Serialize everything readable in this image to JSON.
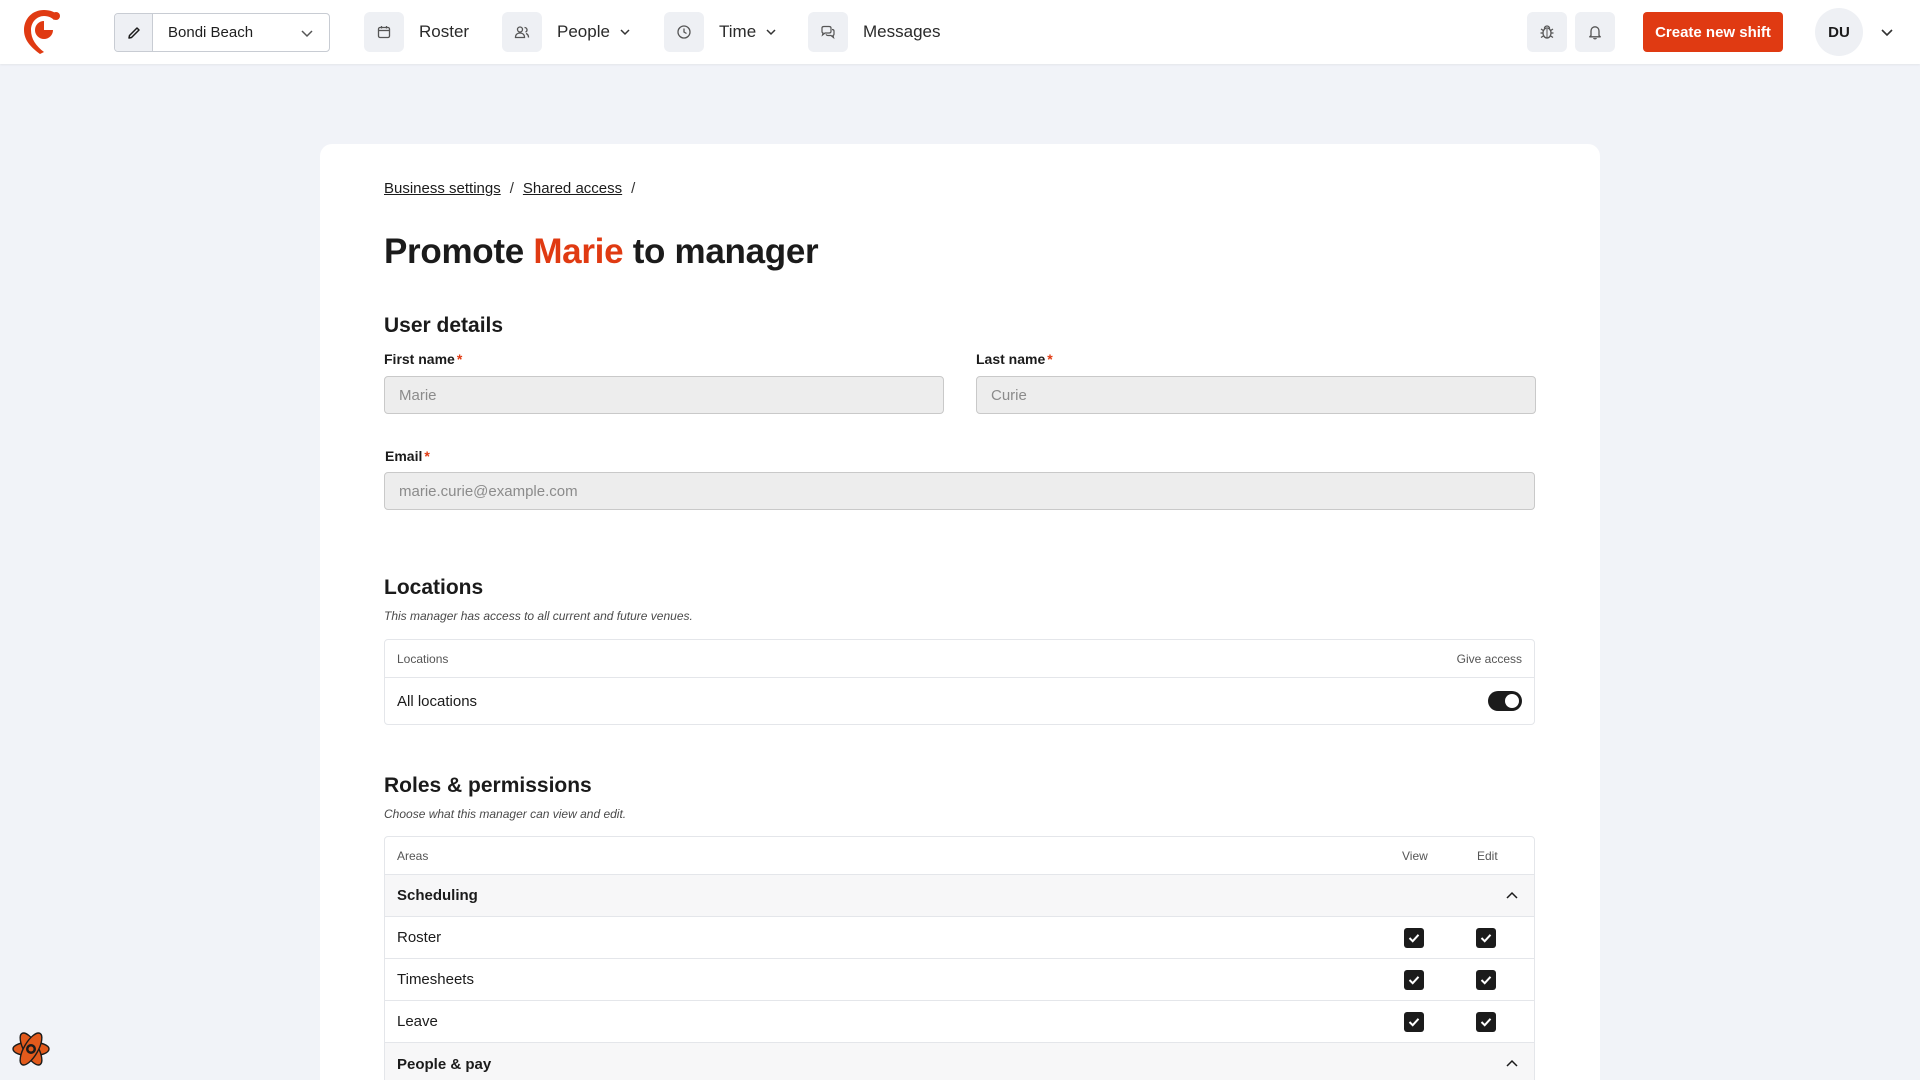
{
  "topbar": {
    "location": "Bondi Beach",
    "nav": [
      {
        "label": "Roster",
        "icon": "calendar-icon"
      },
      {
        "label": "People",
        "icon": "people-icon"
      },
      {
        "label": "Time",
        "icon": "clock-icon"
      },
      {
        "label": "Messages",
        "icon": "chat-icon"
      }
    ],
    "create_button": "Create new shift",
    "avatar_initials": "DU",
    "brand_color": "#e03a12"
  },
  "breadcrumb": [
    "Business settings",
    "Shared access"
  ],
  "breadcrumb_separator": "/",
  "title": {
    "prefix": "Promote",
    "name": "Marie",
    "suffix": "to manager"
  },
  "user_details": {
    "heading": "User details",
    "first_name": {
      "label": "First name",
      "required": "*",
      "placeholder": "Marie"
    },
    "last_name": {
      "label": "Last name",
      "required": "*",
      "placeholder": "Curie"
    },
    "email": {
      "label": "Email",
      "required": "*",
      "placeholder": "marie.curie@example.com"
    }
  },
  "locations": {
    "heading": "Locations",
    "subtitle": "This manager has access to all current and future venues.",
    "col_locations": "Locations",
    "col_access": "Give access",
    "rows": [
      {
        "label": "All locations",
        "enabled": true
      }
    ]
  },
  "roles": {
    "heading": "Roles & permissions",
    "subtitle": "Choose what this manager can view and edit.",
    "col_areas": "Areas",
    "col_view": "View",
    "col_edit": "Edit",
    "groups": [
      {
        "name": "Scheduling",
        "items": [
          {
            "label": "Roster",
            "view": true,
            "edit": true
          },
          {
            "label": "Timesheets",
            "view": true,
            "edit": true
          },
          {
            "label": "Leave",
            "view": true,
            "edit": true
          }
        ]
      },
      {
        "name": "People & pay",
        "items": []
      }
    ]
  }
}
